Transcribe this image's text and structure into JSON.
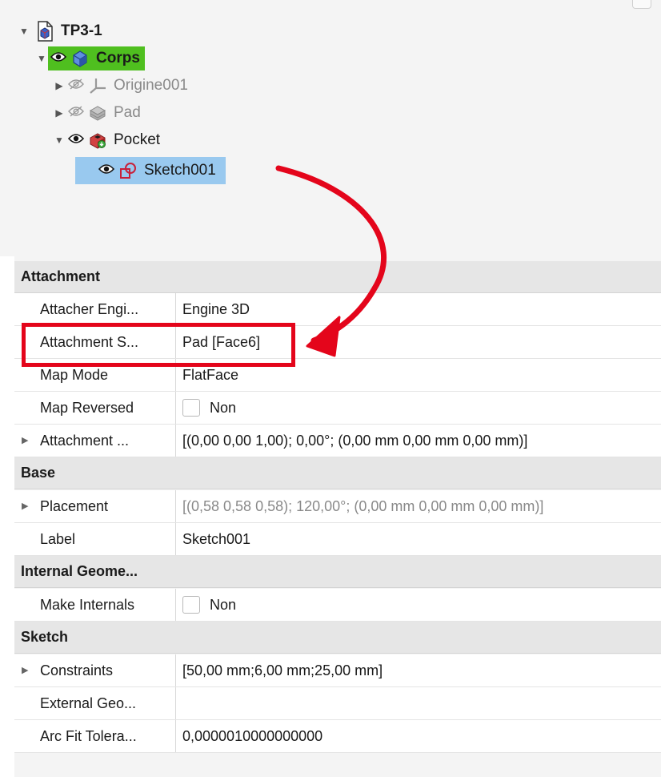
{
  "tree": {
    "nodes": [
      {
        "id": "tp3",
        "label": "TP3-1",
        "arrow": "▼",
        "eye": "",
        "muted": false
      },
      {
        "id": "corps",
        "label": "Corps",
        "arrow": "▼",
        "eye": "visible",
        "muted": false,
        "selected_color": "#4fbf1f"
      },
      {
        "id": "origine",
        "label": "Origine001",
        "arrow": "▶",
        "eye": "hidden",
        "muted": true
      },
      {
        "id": "pad",
        "label": "Pad",
        "arrow": "▶",
        "eye": "hidden",
        "muted": true
      },
      {
        "id": "pocket",
        "label": "Pocket",
        "arrow": "▼",
        "eye": "visible",
        "muted": false
      },
      {
        "id": "sketch",
        "label": "Sketch001",
        "arrow": "",
        "eye": "visible",
        "muted": false,
        "selected_color": "#99c9ef"
      }
    ],
    "icons": {
      "tp3": "document-icon",
      "corps": "body-icon",
      "origine": "axes-icon",
      "pad": "pad-icon",
      "pocket": "pocket-icon",
      "sketch": "sketch-icon"
    }
  },
  "properties": {
    "groups": {
      "attachment": "Attachment",
      "base": "Base",
      "internal": "Internal Geome...",
      "sketch": "Sketch"
    },
    "rows": {
      "attacher_engine": {
        "name": "Attacher Engi...",
        "value": "Engine 3D"
      },
      "attachment_support": {
        "name": "Attachment S...",
        "value": "Pad [Face6]"
      },
      "map_mode": {
        "name": "Map Mode",
        "value": "FlatFace"
      },
      "map_reversed": {
        "name": "Map Reversed",
        "value": "Non",
        "checked": false
      },
      "attachment_offset": {
        "name": "Attachment ...",
        "value": "[(0,00 0,00 1,00); 0,00°; (0,00 mm  0,00 mm  0,00 mm)]"
      },
      "placement": {
        "name": "Placement",
        "value": "[(0,58 0,58 0,58); 120,00°; (0,00 mm  0,00 mm  0,00 mm)]"
      },
      "label": {
        "name": "Label",
        "value": "Sketch001"
      },
      "make_internals": {
        "name": "Make Internals",
        "value": "Non",
        "checked": false
      },
      "constraints": {
        "name": "Constraints",
        "value": "[50,00 mm;6,00 mm;25,00 mm]"
      },
      "external_geo": {
        "name": "External Geo...",
        "value": ""
      },
      "arc_fit": {
        "name": "Arc Fit Tolera...",
        "value": "0,0000010000000000"
      }
    }
  },
  "annotation": {
    "color": "#e4051b"
  }
}
